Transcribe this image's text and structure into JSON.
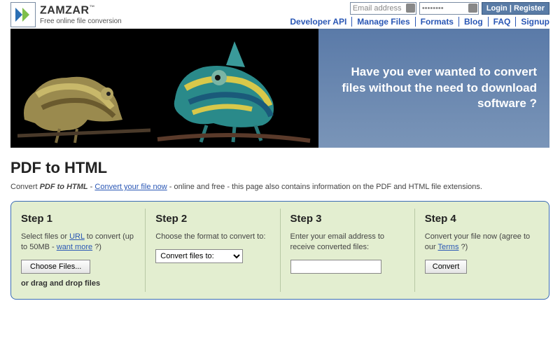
{
  "brand": {
    "name": "ZAMZAR",
    "tm": "™",
    "tagline": "Free online file conversion"
  },
  "login": {
    "email_placeholder": "Email address",
    "password_value": "••••••••",
    "login_label": "Login",
    "register_label": "Register",
    "divider": " | "
  },
  "nav": {
    "items": [
      "Developer API",
      "Manage Files",
      "Formats",
      "Blog",
      "FAQ",
      "Signup"
    ]
  },
  "hero": {
    "message": "Have you ever wanted to convert files without the need to download software ?"
  },
  "page": {
    "title": "PDF to HTML",
    "intro_prefix": "Convert ",
    "intro_bold": "PDF to HTML",
    "intro_dash": " - ",
    "intro_link": "Convert your file now",
    "intro_suffix": " - online and free - this page also contains information on the PDF and HTML file extensions."
  },
  "steps": {
    "s1": {
      "title": "Step 1",
      "text_a": "Select files or ",
      "url_link": "URL",
      "text_b": " to convert (up to 50MB - ",
      "want_more": "want more",
      "text_c": " ?)",
      "choose_label": "Choose Files...",
      "dragdrop": "or drag and drop files"
    },
    "s2": {
      "title": "Step 2",
      "text": "Choose the format to convert to:",
      "select_label": "Convert files to:"
    },
    "s3": {
      "title": "Step 3",
      "text": "Enter your email address to receive converted files:"
    },
    "s4": {
      "title": "Step 4",
      "text_a": "Convert your file now (agree to our ",
      "terms": "Terms",
      "text_b": " ?)",
      "button": "Convert"
    }
  }
}
